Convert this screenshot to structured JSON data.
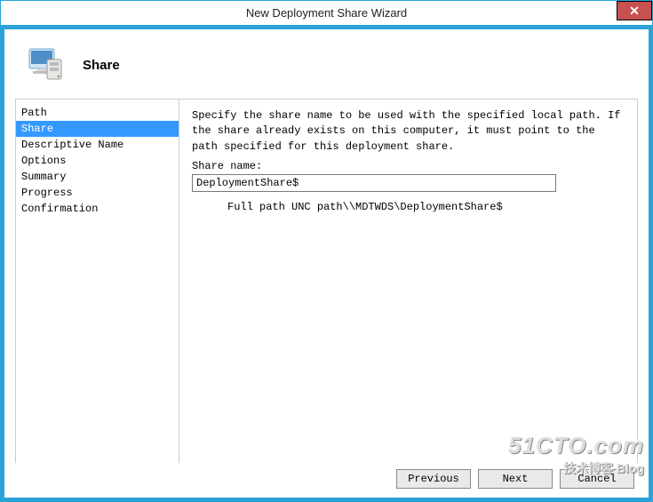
{
  "window": {
    "title": "New Deployment Share Wizard",
    "close_glyph": "✕"
  },
  "header": {
    "title": "Share"
  },
  "sidebar": {
    "items": [
      {
        "label": "Path",
        "selected": false
      },
      {
        "label": "Share",
        "selected": true
      },
      {
        "label": "Descriptive Name",
        "selected": false
      },
      {
        "label": "Options",
        "selected": false
      },
      {
        "label": "Summary",
        "selected": false
      },
      {
        "label": "Progress",
        "selected": false
      },
      {
        "label": "Confirmation",
        "selected": false
      }
    ]
  },
  "main": {
    "instruction": "Specify the share name to be used with the specified local path.  If the share already exists on this computer, it must point to the path specified for this deployment share.",
    "share_name_label": "Share name:",
    "share_name_value": "DeploymentShare$",
    "unc_label": "Full path UNC path",
    "unc_value": "\\\\MDTWDS\\DeploymentShare$"
  },
  "buttons": {
    "previous": "Previous",
    "next": "Next",
    "cancel": "Cancel"
  },
  "watermark": {
    "line1": "51CTO.com",
    "line2": "技术博客 Blog"
  }
}
